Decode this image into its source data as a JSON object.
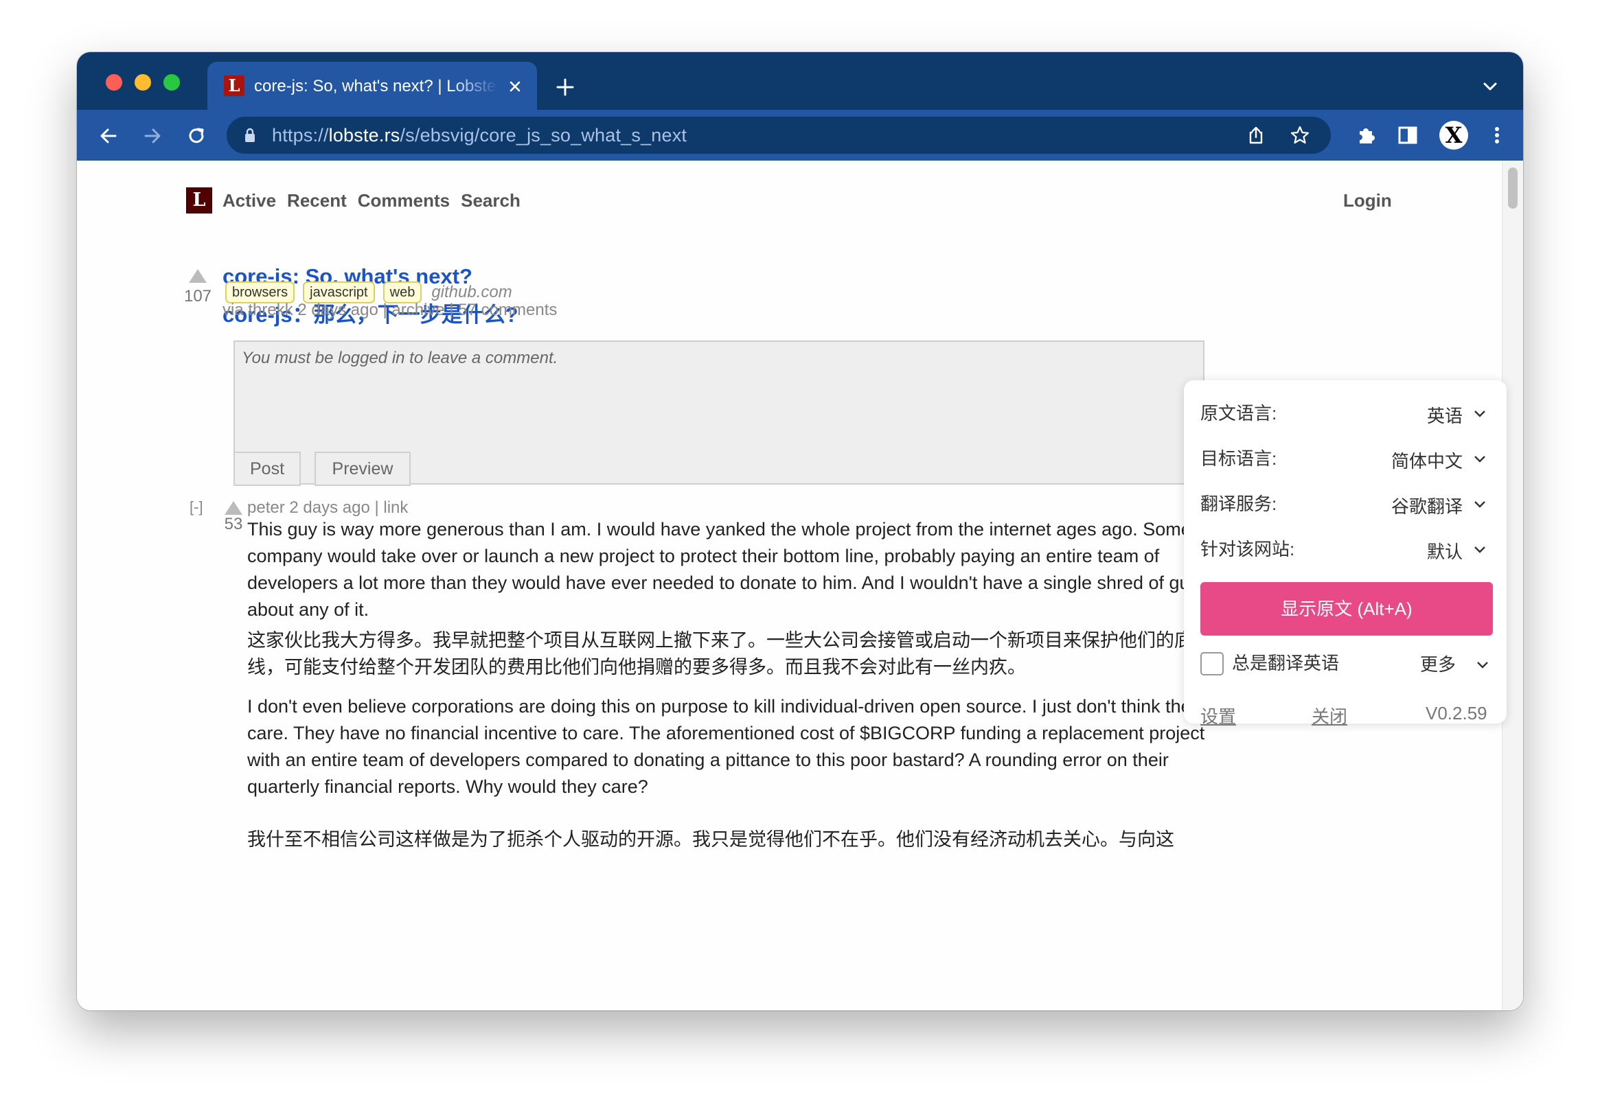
{
  "browser": {
    "tab_title": "core-js: So, what's next? | Lobsters",
    "favicon_letter": "L",
    "url_prefix": "https://",
    "url_host": "lobste.rs",
    "url_path": "/s/ebsvig/core_js_so_what_s_next",
    "profile_letter": "X"
  },
  "site": {
    "logo_letter": "L",
    "nav": [
      "Active",
      "Recent",
      "Comments",
      "Search"
    ],
    "login": "Login"
  },
  "story": {
    "score": "107",
    "title": "core-js: So, what's next?",
    "title_translated": "core-js：那么，下一步是什么?",
    "tags": [
      "browsers",
      "javascript",
      "web"
    ],
    "domain": "github.com",
    "byline": "via threkk 2 days ago | archive | 57 comments"
  },
  "comment_form": {
    "placeholder": "You must be logged in to leave a comment.",
    "post_label": "Post",
    "preview_label": "Preview"
  },
  "comment": {
    "collapse": "[-]",
    "score": "53",
    "meta": "peter 2 days ago | link",
    "para1": "This guy is way more generous than I am. I would have yanked the whole project from the internet ages ago. Some big company would take over or launch a new project to protect their bottom line, probably paying an entire team of developers a lot more than they would have ever needed to donate to him. And I wouldn't have a single shred of guilt about any of it.",
    "para1_translated": "这家伙比我大方得多。我早就把整个项目从互联网上撤下来了。一些大公司会接管或启动一个新项目来保护他们的底线，可能支付给整个开发团队的费用比他们向他捐赠的要多得多。而且我不会对此有一丝内疚。",
    "para2": "I don't even believe corporations are doing this on purpose to kill individual-driven open source. I just don't think they care. They have no financial incentive to care. The aforementioned cost of $BIGCORP funding a replacement project with an entire team of developers compared to donating a pittance to this poor bastard? A rounding error on their quarterly financial reports. Why would they care?",
    "para2_translated": "我什至不相信公司这样做是为了扼杀个人驱动的开源。我只是觉得他们不在乎。他们没有经济动机去关心。与向这"
  },
  "translator": {
    "source_label": "原文语言:",
    "source_value": "英语",
    "target_label": "目标语言:",
    "target_value": "简体中文",
    "service_label": "翻译服务:",
    "service_value": "谷歌翻译",
    "site_label": "针对该网站:",
    "site_value": "默认",
    "show_original": "显示原文 (Alt+A)",
    "always_translate": "总是翻译英语",
    "more": "更多",
    "settings": "设置",
    "close": "关闭",
    "version": "V0.2.59",
    "accent_color": "#e84a88"
  }
}
